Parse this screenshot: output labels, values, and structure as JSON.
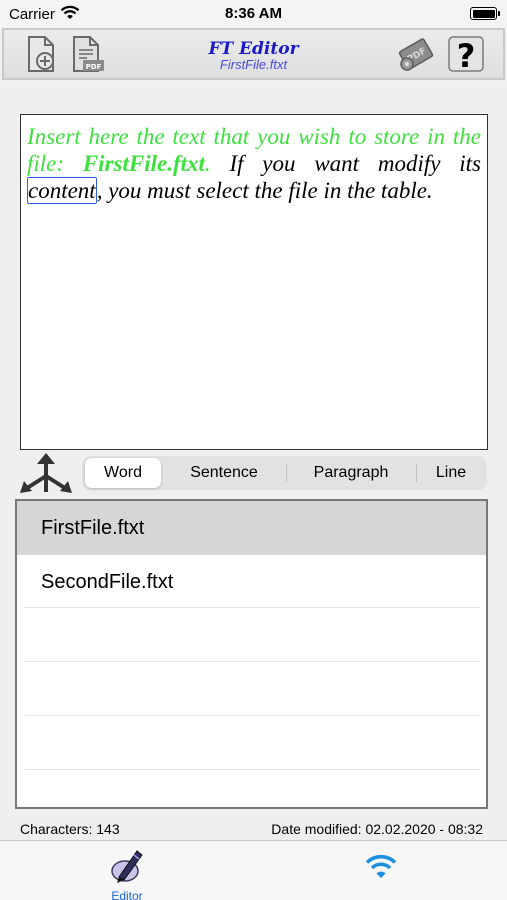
{
  "status_bar": {
    "carrier": "Carrier",
    "time": "8:36 AM"
  },
  "header": {
    "title": "FT Editor",
    "subtitle": "FirstFile.ftxt"
  },
  "icons": [
    "new-file-icon",
    "pdf-file-icon",
    "pdf-settings-icon",
    "help-icon",
    "move-arrows-icon",
    "pen-editor-icon",
    "wifi-icon"
  ],
  "editor": {
    "intro": "Insert here the text that you wish to store in the file: ",
    "filename": "FirstFile.ftxt",
    "period": ".",
    "sentence_start": " If you want modify its ",
    "selected_word": "content",
    "sentence_end": ", you must select the file in the table."
  },
  "selection_mode": {
    "options": [
      "Word",
      "Sentence",
      "Paragraph",
      "Line"
    ],
    "selected": "Word"
  },
  "files": [
    {
      "name": "FirstFile.ftxt",
      "selected": true
    },
    {
      "name": "SecondFile.ftxt",
      "selected": false
    }
  ],
  "info": {
    "characters": "Characters: 143",
    "date_modified": "Date modified: 02.02.2020 - 08:32"
  },
  "tab_bar": {
    "editor_label": "Editor",
    "active_color": "#1565d8"
  },
  "colors": {
    "title_blue": "#1a1ac8",
    "highlight_green": "#3ee03e",
    "selection_border": "#2d5ce0"
  }
}
